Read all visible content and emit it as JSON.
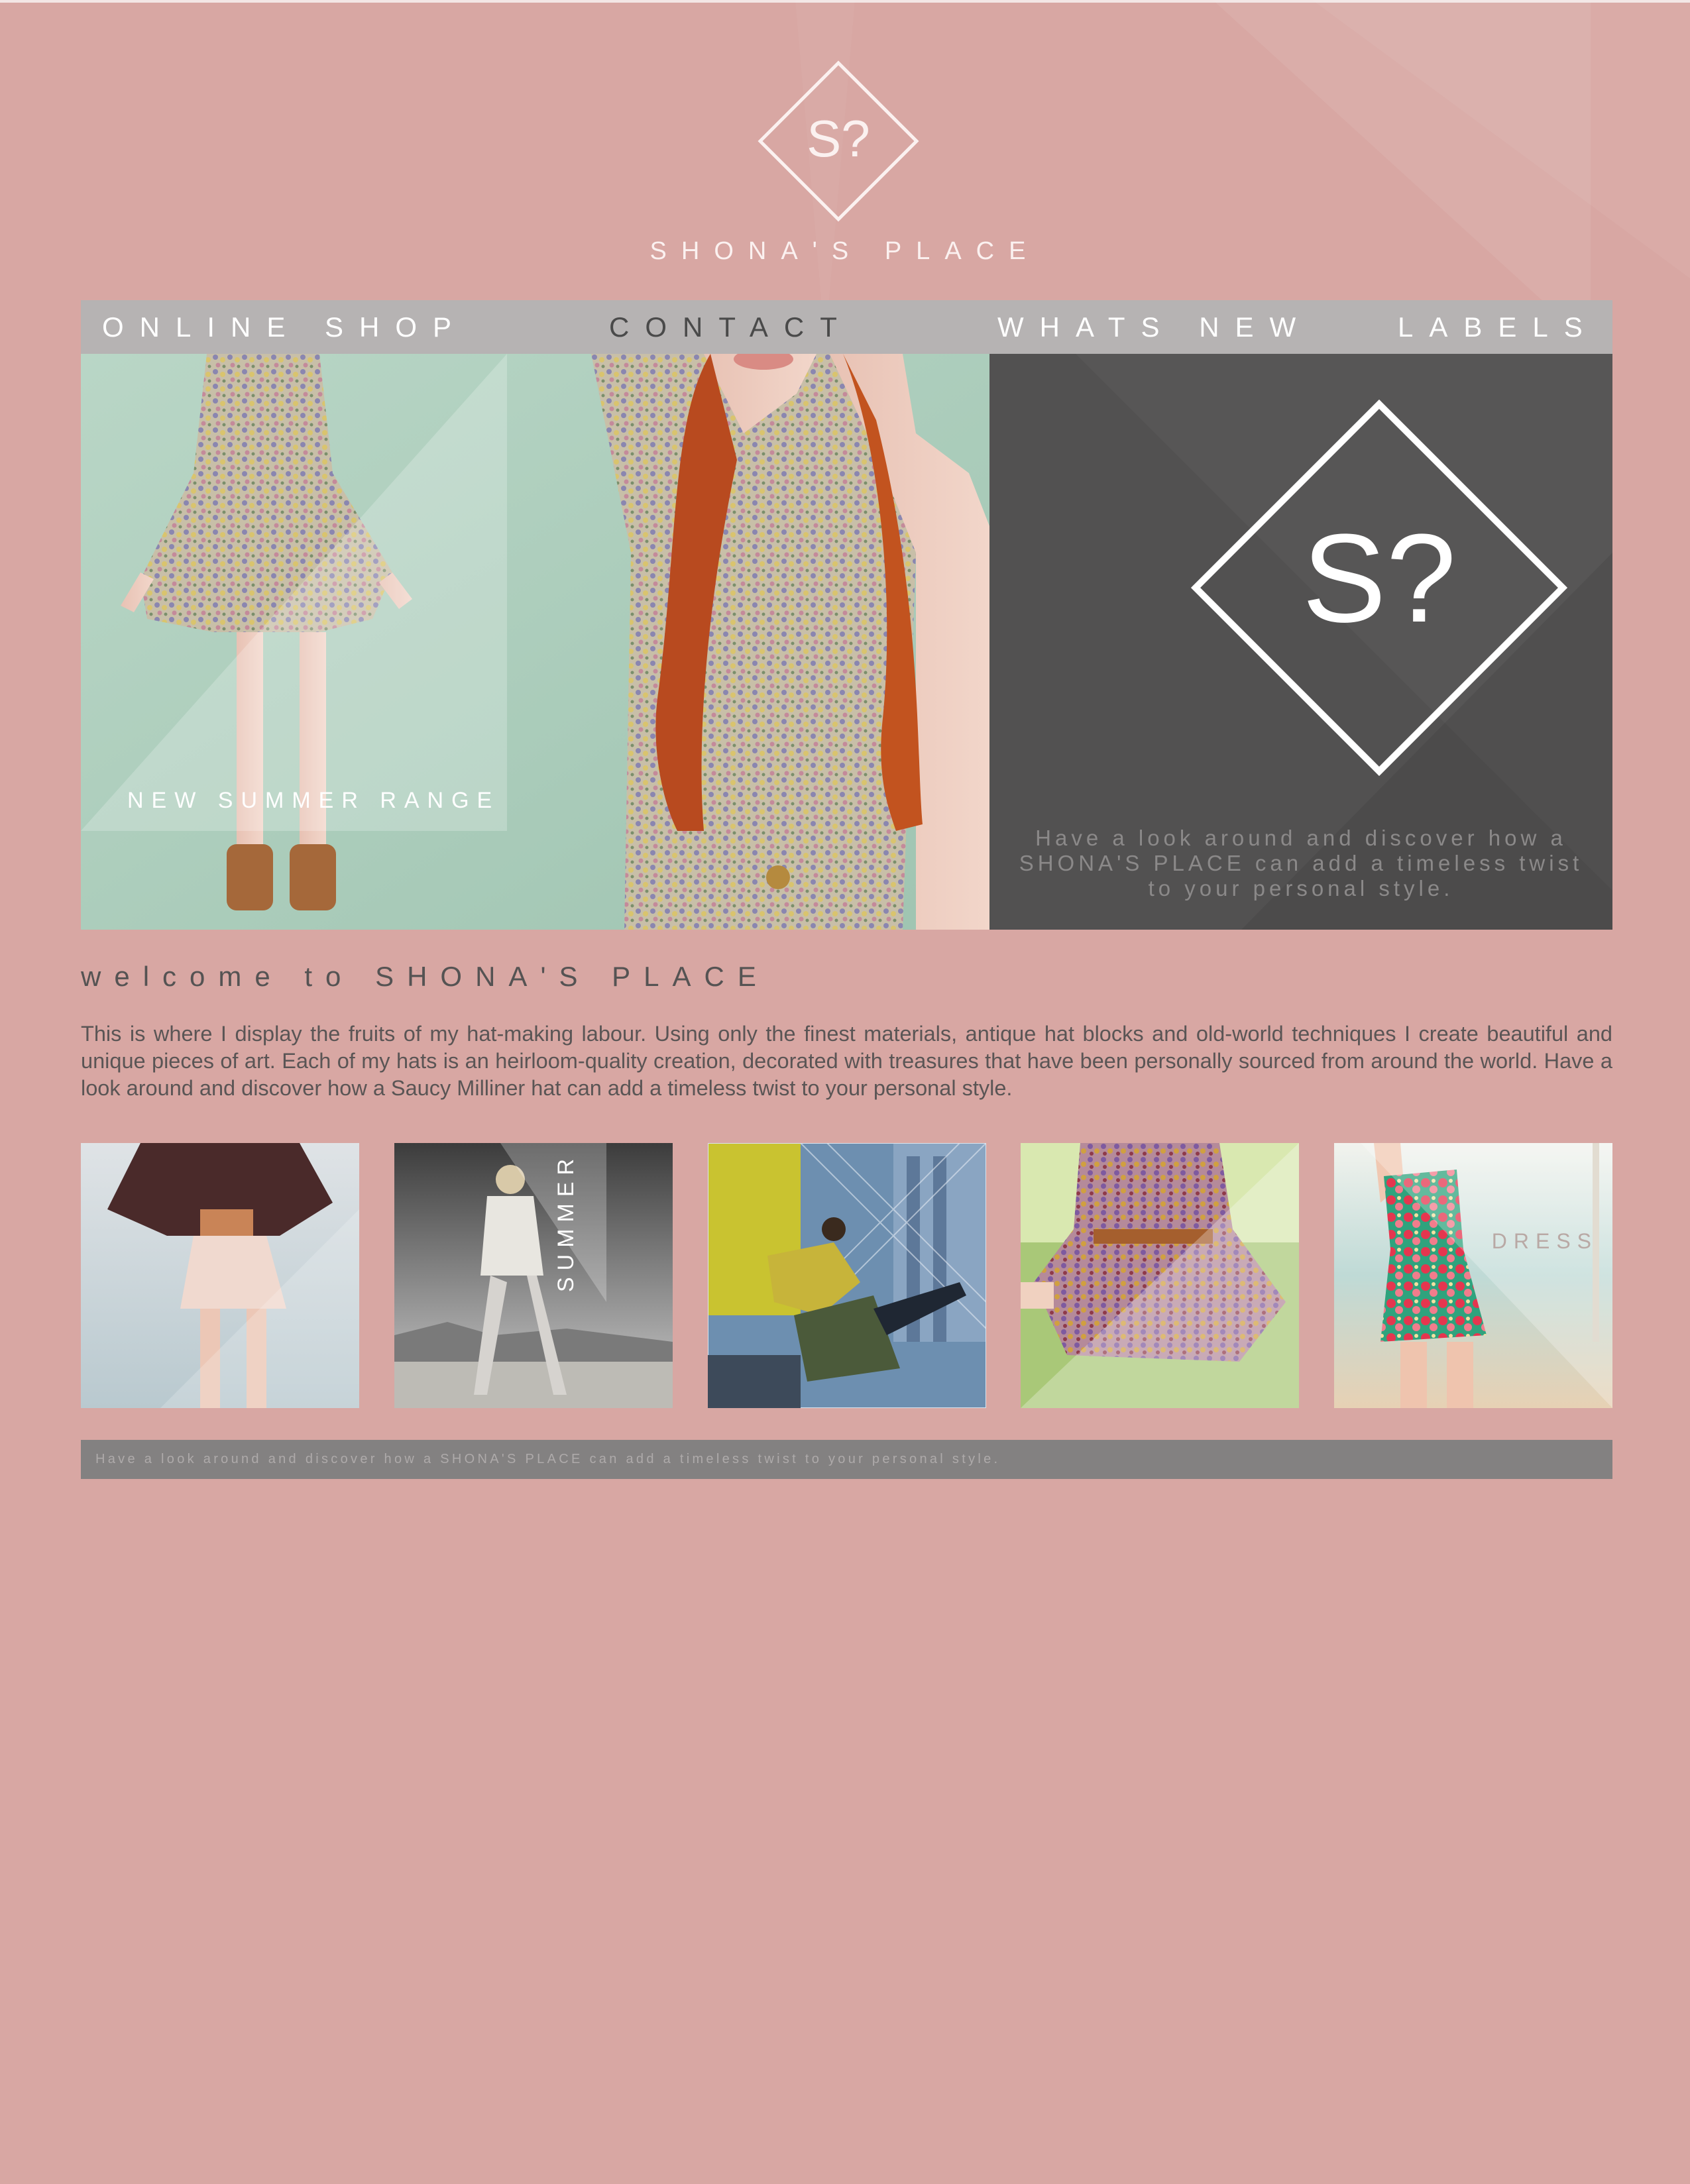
{
  "site": {
    "logo_mark": "S?",
    "name": "SHONA'S PLACE"
  },
  "nav": {
    "items": [
      {
        "label": "ONLINE SHOP"
      },
      {
        "label": "CONTACT"
      },
      {
        "label": "WHATS NEW"
      },
      {
        "label": "LABELS"
      }
    ]
  },
  "hero": {
    "caption": "NEW SUMMER RANGE",
    "tagline": "Have a look around and discover how a SHONA'S PLACE can add a timeless twist to your personal style."
  },
  "welcome": {
    "title": "welcome to SHONA'S PLACE",
    "body": "This is where I display the fruits of my hat-making labour. Using only the finest materials, antique hat blocks and old-world techniques I create beautiful and unique pieces of art. Each of my hats is an heirloom-quality creation, decorated with treasures that have been personally sourced from around the world. Have a look around and discover how a Saucy Milliner hat can add a timeless twist to your personal style."
  },
  "gallery": {
    "summer_label": "SUMMER",
    "dress_label": "DRESS"
  },
  "footer": {
    "text": "Have a look around and discover how a SHONA'S PLACE can add a timeless twist to your personal style."
  },
  "colors": {
    "background": "#d8a7a3",
    "nav_bar": "#b6b3b3",
    "hero_panel": "#525151",
    "footer_bar": "#838181"
  }
}
